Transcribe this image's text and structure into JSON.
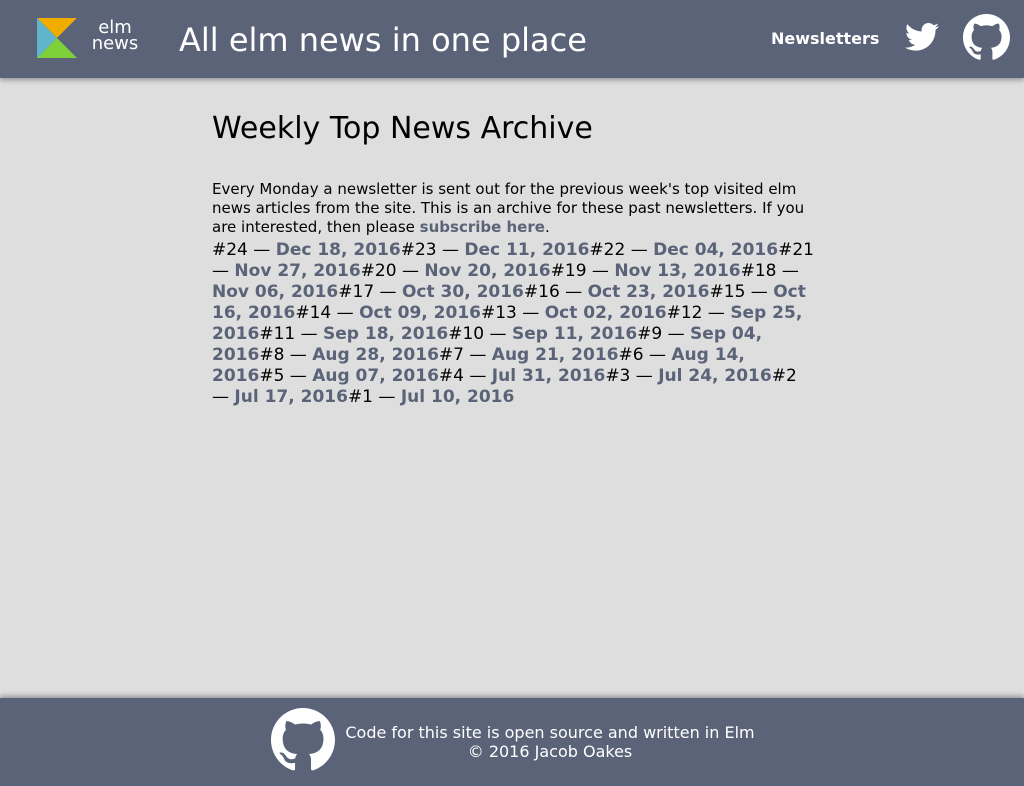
{
  "header": {
    "logo_text_1": "elm",
    "logo_text_2": "news",
    "tagline": "All elm news in one place",
    "nav_newsletters": "Newsletters",
    "icons": [
      "elm-logo-icon",
      "twitter-icon",
      "github-icon"
    ]
  },
  "main": {
    "title": "Weekly Top News Archive",
    "intro_text": "Every Monday a newsletter is sent out for the previous week's top visited elm news articles from the site. This is an archive for these past newsletters. If you are interested, then please ",
    "subscribe_link": "subscribe here",
    "intro_end": ".",
    "issues": [
      {
        "number": "#24",
        "date": "Dec 18, 2016"
      },
      {
        "number": "#23",
        "date": "Dec 11, 2016"
      },
      {
        "number": "#22",
        "date": "Dec 04, 2016"
      },
      {
        "number": "#21",
        "date": "Nov 27, 2016"
      },
      {
        "number": "#20",
        "date": "Nov 20, 2016"
      },
      {
        "number": "#19",
        "date": "Nov 13, 2016"
      },
      {
        "number": "#18",
        "date": "Nov 06, 2016"
      },
      {
        "number": "#17",
        "date": "Oct 30, 2016"
      },
      {
        "number": "#16",
        "date": "Oct 23, 2016"
      },
      {
        "number": "#15",
        "date": "Oct 16, 2016"
      },
      {
        "number": "#14",
        "date": "Oct 09, 2016"
      },
      {
        "number": "#13",
        "date": "Oct 02, 2016"
      },
      {
        "number": "#12",
        "date": "Sep 25, 2016"
      },
      {
        "number": "#11",
        "date": "Sep 18, 2016"
      },
      {
        "number": "#10",
        "date": "Sep 11, 2016"
      },
      {
        "number": "#9",
        "date": "Sep 04, 2016"
      },
      {
        "number": "#8",
        "date": "Aug 28, 2016"
      },
      {
        "number": "#7",
        "date": "Aug 21, 2016"
      },
      {
        "number": "#6",
        "date": "Aug 14, 2016"
      },
      {
        "number": "#5",
        "date": "Aug 07, 2016"
      },
      {
        "number": "#4",
        "date": "Jul 31, 2016"
      },
      {
        "number": "#3",
        "date": "Jul 24, 2016"
      },
      {
        "number": "#2",
        "date": "Jul 17, 2016"
      },
      {
        "number": "#1",
        "date": "Jul 10, 2016"
      }
    ],
    "separator": " — "
  },
  "footer": {
    "line1": "Code for this site is open source and written in Elm",
    "line2": "© 2016 Jacob Oakes",
    "icon": "github-icon"
  },
  "colors": {
    "header_bg": "#5a6378",
    "page_bg": "#dedede",
    "link": "#5a6378",
    "text": "#000000",
    "header_text": "#ffffff"
  }
}
